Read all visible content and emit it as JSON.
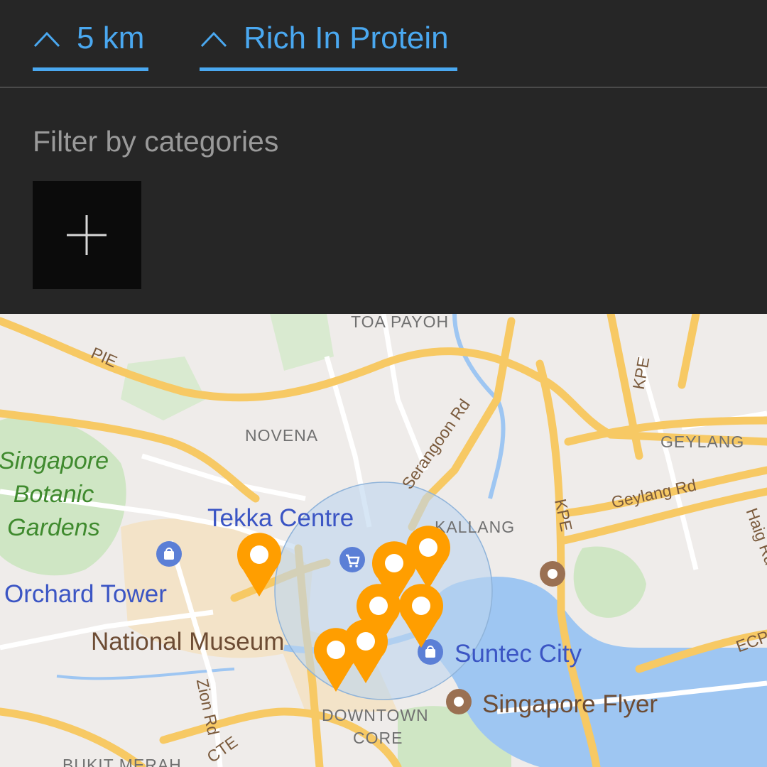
{
  "filters": {
    "distance_label": "5 km",
    "diet_label": "Rich In Protein"
  },
  "categories": {
    "heading": "Filter by categories"
  },
  "map": {
    "areas": [
      "TOA PAYOH",
      "NOVENA",
      "GEYLANG",
      "KALLANG",
      "DOWNTOWN",
      "CORE",
      "BUKIT MERAH"
    ],
    "roads": [
      "PIE",
      "KPE",
      "KPE",
      "Serangoon Rd",
      "Geylang Rd",
      "Zion Rd",
      "CTE",
      "ECP",
      "Haig Rd"
    ],
    "pois": {
      "botanic_gardens": [
        "Singapore",
        "Botanic",
        "Gardens"
      ],
      "tekka": "Tekka Centre",
      "orchard": "Orchard Tower",
      "museum": "National Museum",
      "suntec": "Suntec City",
      "flyer": "Singapore Flyer"
    },
    "colors": {
      "pin": "#ff9e00",
      "radius_fill": "#bcd6ee",
      "water": "#9ec6f2",
      "road": "#f7c964"
    }
  }
}
